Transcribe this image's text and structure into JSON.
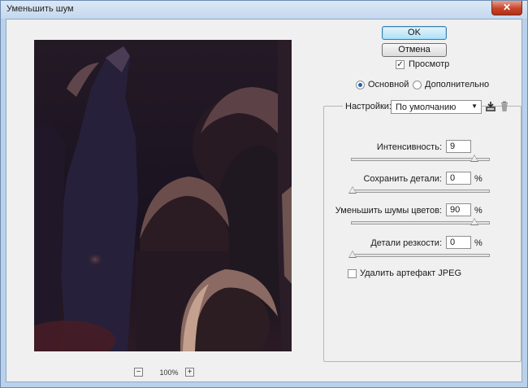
{
  "window": {
    "title": "Уменьшить шум",
    "close_glyph": "✕"
  },
  "buttons": {
    "ok": "OK",
    "cancel": "Отмена"
  },
  "preview_toggle": {
    "label": "Просмотр",
    "checked": true
  },
  "mode": {
    "basic": {
      "label": "Основной",
      "selected": true
    },
    "advanced": {
      "label": "Дополнительно",
      "selected": false
    }
  },
  "settings": {
    "label": "Настройки:",
    "value": "По умолчанию",
    "save_icon": "save-preset-icon",
    "delete_icon": "trash-icon"
  },
  "controls": {
    "strength": {
      "label": "Интенсивность:",
      "value": "9",
      "unit": "",
      "level": 0.9
    },
    "preserve_details": {
      "label": "Сохранить детали:",
      "value": "0",
      "unit": "%",
      "level": 0.0
    },
    "reduce_color_noise": {
      "label": "Уменьшить шумы цветов:",
      "value": "90",
      "unit": "%",
      "level": 0.9
    },
    "sharpen_details": {
      "label": "Детали резкости:",
      "value": "0",
      "unit": "%",
      "level": 0.0
    }
  },
  "jpeg_artifact": {
    "label": "Удалить артефакт JPEG",
    "checked": false
  },
  "zoom": {
    "minus": "−",
    "level": "100%",
    "plus": "+"
  },
  "colors": {
    "ok_button": "#aee0f6",
    "preview_background": "#1e1420"
  }
}
